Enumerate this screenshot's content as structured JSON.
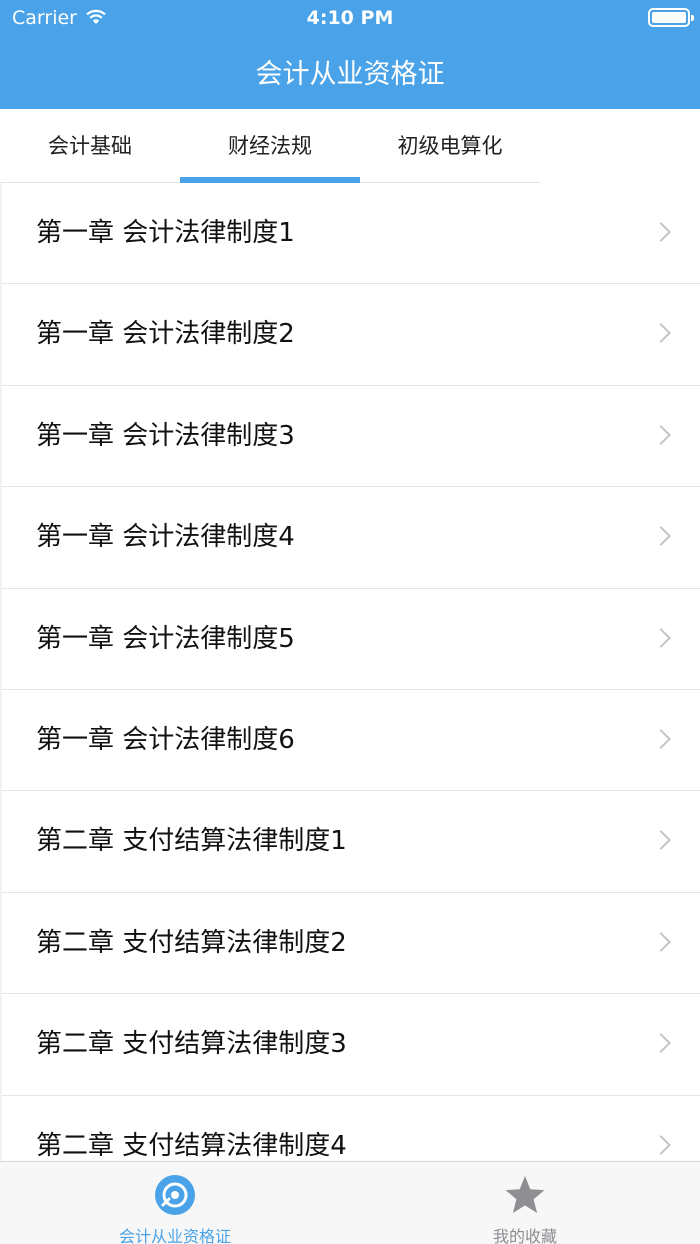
{
  "status_bar": {
    "carrier": "Carrier",
    "time": "4:10 PM"
  },
  "header": {
    "title": "会计从业资格证"
  },
  "tabs": [
    {
      "label": "会计基础",
      "selected": false
    },
    {
      "label": "财经法规",
      "selected": true
    },
    {
      "label": "初级电算化",
      "selected": false
    }
  ],
  "list": {
    "items": [
      {
        "label": "第一章 会计法律制度1"
      },
      {
        "label": "第一章 会计法律制度2"
      },
      {
        "label": "第一章 会计法律制度3"
      },
      {
        "label": "第一章 会计法律制度4"
      },
      {
        "label": "第一章 会计法律制度5"
      },
      {
        "label": "第一章 会计法律制度6"
      },
      {
        "label": "第二章 支付结算法律制度1"
      },
      {
        "label": "第二章 支付结算法律制度2"
      },
      {
        "label": "第二章 支付结算法律制度3"
      },
      {
        "label": "第二章 支付结算法律制度4"
      }
    ]
  },
  "tab_bar": {
    "items": [
      {
        "label": "会计从业资格证",
        "icon": "disc-icon",
        "active": true
      },
      {
        "label": "我的收藏",
        "icon": "star-icon",
        "active": false
      }
    ]
  },
  "colors": {
    "accent": "#4aa3e8",
    "inactive": "#8e8e93"
  }
}
